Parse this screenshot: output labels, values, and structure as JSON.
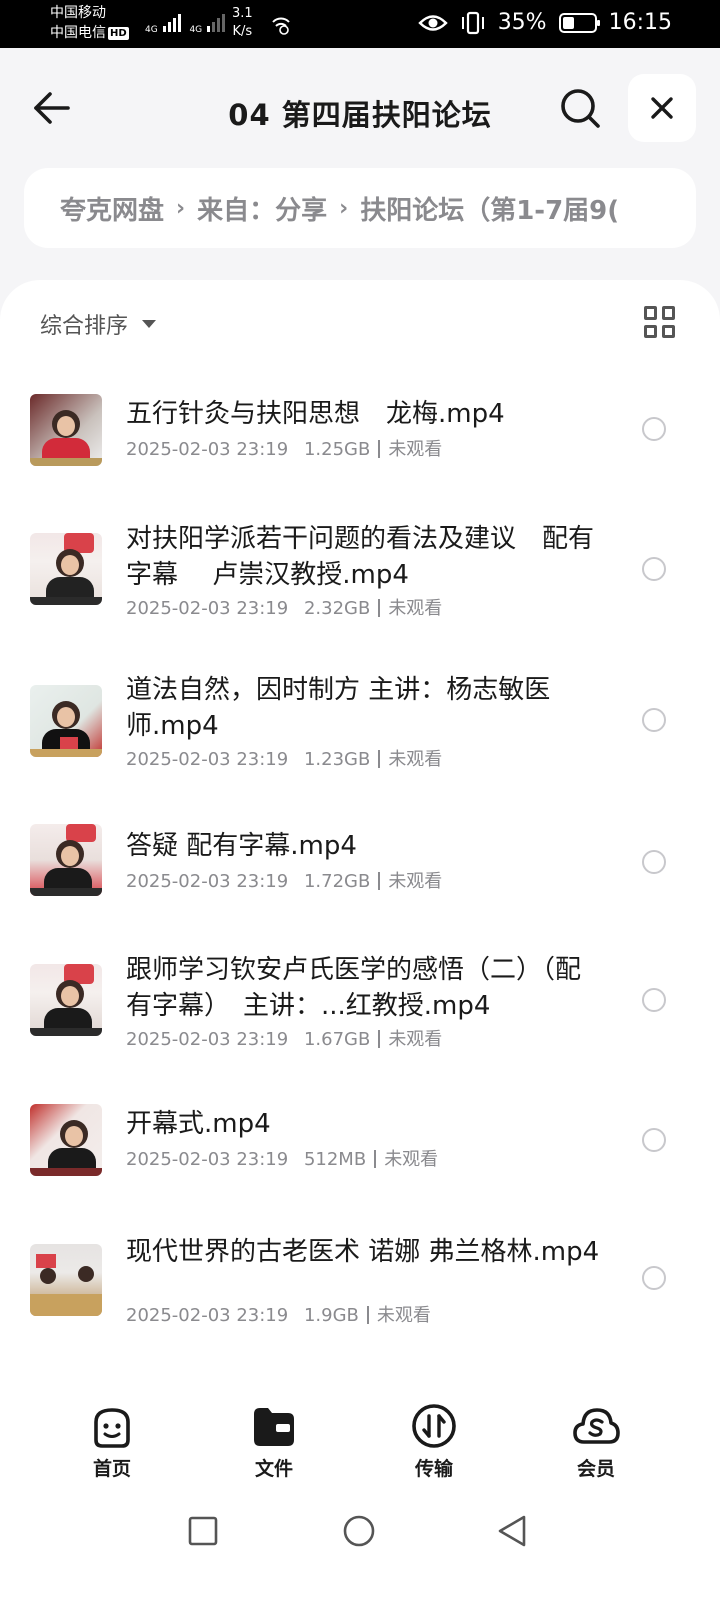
{
  "status_bar": {
    "carrier1": "中国移动",
    "carrier2": "中国电信",
    "hd_badge": "HD",
    "net1": "4G",
    "net2": "4G",
    "speed_value": "3.1",
    "speed_unit": "K/s",
    "battery_percent": "35%",
    "time": "16:15"
  },
  "header": {
    "title": "04 第四届扶阳论坛"
  },
  "breadcrumb": {
    "items": [
      "夸克网盘",
      "来自：分享",
      "扶阳论坛（第1-7届9("
    ],
    "separator": "›"
  },
  "toolbar": {
    "sort_label": "综合排序"
  },
  "files": [
    {
      "name": "五行针灸与扶阳思想　龙梅.mp4",
      "date": "2025-02-03 23:19",
      "size": "1.25GB",
      "status": "未观看"
    },
    {
      "name": "对扶阳学派若干问题的看法及建议　配有字幕　 卢崇汉教授.mp4",
      "date": "2025-02-03 23:19",
      "size": "2.32GB",
      "status": "未观看"
    },
    {
      "name": "道法自然，因时制方 主讲：杨志敏医师.mp4",
      "date": "2025-02-03 23:19",
      "size": "1.23GB",
      "status": "未观看"
    },
    {
      "name": "答疑  配有字幕.mp4",
      "date": "2025-02-03 23:19",
      "size": "1.72GB",
      "status": "未观看"
    },
    {
      "name": "跟师学习钦安卢氏医学的感悟（二）（配有字幕）　主讲：...红教授.mp4",
      "date": "2025-02-03 23:19",
      "size": "1.67GB",
      "status": "未观看"
    },
    {
      "name": "开幕式.mp4",
      "date": "2025-02-03 23:19",
      "size": "512MB",
      "status": "未观看"
    },
    {
      "name": "现代世界的古老医术 诺娜 弗兰格林.mp4",
      "date": "2025-02-03 23:19",
      "size": "1.9GB",
      "status": "未观看"
    }
  ],
  "bottom_nav": {
    "home": "首页",
    "files": "文件",
    "transfer": "传输",
    "member": "会员"
  },
  "colors": {
    "background": "#f5f5f7",
    "card": "#ffffff",
    "text_primary": "#1a1a1a",
    "text_secondary": "#8a8a8e",
    "thumbnail_red": "#c0302c"
  }
}
